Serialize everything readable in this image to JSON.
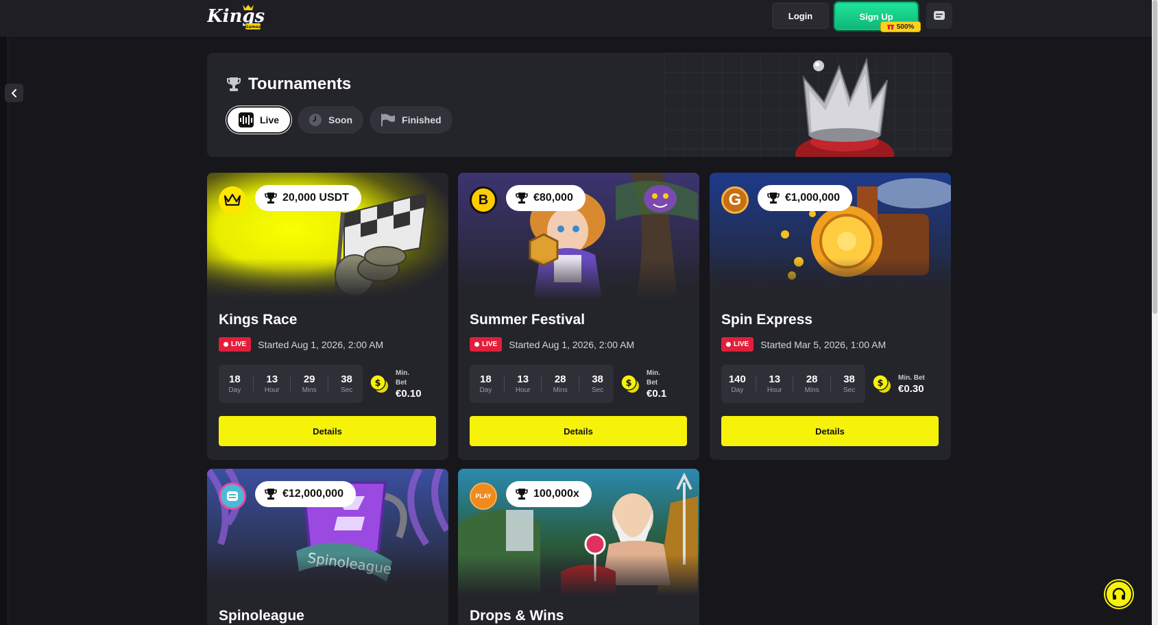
{
  "header": {
    "logo_text": "Kings",
    "logo_sub": "Gamez",
    "login_label": "Login",
    "signup_label": "Sign Up",
    "signup_badge": "500%"
  },
  "hero": {
    "title": "Tournaments",
    "tabs": [
      {
        "label": "Live",
        "icon": "soundwave-icon",
        "active": true
      },
      {
        "label": "Soon",
        "icon": "clock-icon",
        "active": false
      },
      {
        "label": "Finished",
        "icon": "flag-icon",
        "active": false
      }
    ]
  },
  "cards": [
    {
      "title": "Kings Race",
      "prize": "20,000 USDT",
      "provider_icon": "crown-icon",
      "provider_color": "#ffe600",
      "live_label": "LIVE",
      "started": "Started Aug 1, 2026, 2:00 AM",
      "timer": {
        "day": "18",
        "hour": "13",
        "mins": "29",
        "sec": "38"
      },
      "min_bet_label1": "Min.",
      "min_bet_label2": "Bet",
      "min_bet_value": "€0.10",
      "details_label": "Details"
    },
    {
      "title": "Summer Festival",
      "prize": "€80,000",
      "provider_icon": "b-letter-icon",
      "provider_color": "#ffcc00",
      "live_label": "LIVE",
      "started": "Started Aug 1, 2026, 2:00 AM",
      "timer": {
        "day": "18",
        "hour": "13",
        "mins": "28",
        "sec": "38"
      },
      "min_bet_label1": "Min.",
      "min_bet_label2": "Bet",
      "min_bet_value": "€0.1",
      "details_label": "Details"
    },
    {
      "title": "Spin Express",
      "prize": "€1,000,000",
      "provider_icon": "g-letter-icon",
      "provider_color": "#c86f12",
      "live_label": "LIVE",
      "started": "Started Mar 5, 2026, 1:00 AM",
      "timer": {
        "day": "140",
        "hour": "13",
        "mins": "28",
        "sec": "38"
      },
      "min_bet_label1": "Min. Bet",
      "min_bet_label2": "",
      "min_bet_value": "€0.30",
      "details_label": "Details"
    },
    {
      "title": "Spinoleague",
      "prize": "€12,000,000",
      "provider_icon": "spinomenal-icon",
      "provider_color": "#4fb8d8",
      "banner_text": "Spinoleague"
    },
    {
      "title": "Drops & Wins",
      "prize": "100,000x",
      "provider_icon": "pragmatic-play-icon",
      "provider_color": "#f08a1c",
      "provider_text": "PLAY"
    }
  ],
  "timer_labels": {
    "day": "Day",
    "hour": "Hour",
    "mins": "Mins",
    "sec": "Sec"
  },
  "colors": {
    "accent_yellow": "#f6f20a",
    "signup_green": "#13d087",
    "live_red": "#e21f3b",
    "bg": "#16161b",
    "card_bg": "#24242b"
  }
}
